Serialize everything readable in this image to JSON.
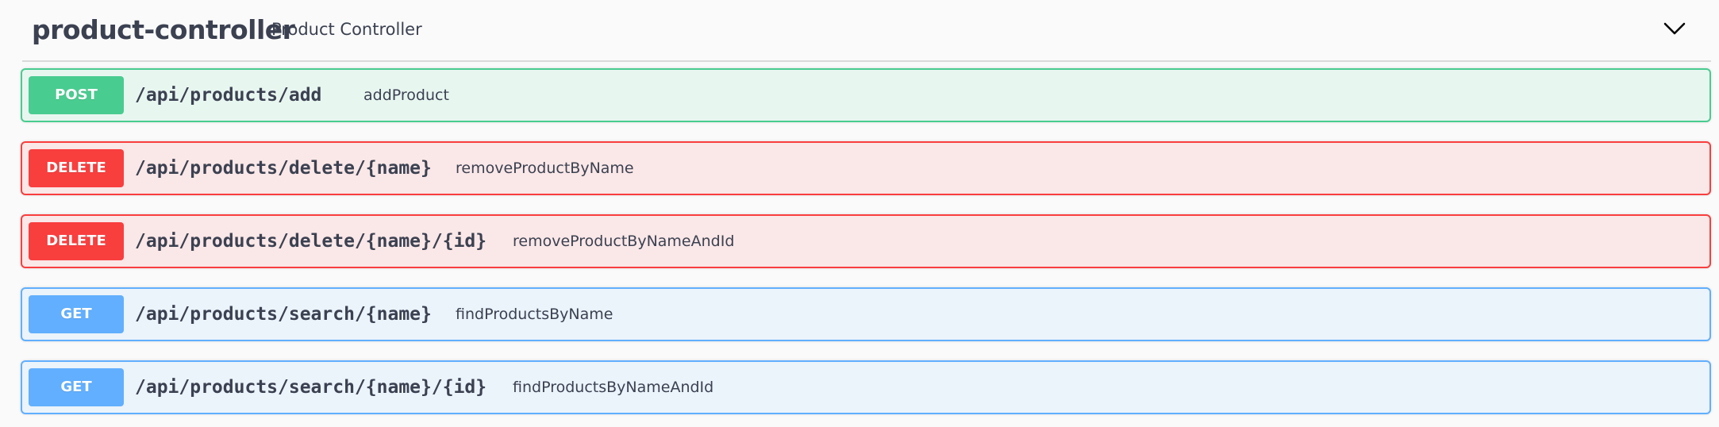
{
  "controller": {
    "name": "product-controller",
    "description": "Product Controller",
    "expand_icon": "chevron-down-icon"
  },
  "operations": [
    {
      "method": "POST",
      "path": "/api/products/add",
      "summary": "addProduct"
    },
    {
      "method": "DELETE",
      "path": "/api/products/delete/{name}",
      "summary": "removeProductByName"
    },
    {
      "method": "DELETE",
      "path": "/api/products/delete/{name}/{id}",
      "summary": "removeProductByNameAndId"
    },
    {
      "method": "GET",
      "path": "/api/products/search/{name}",
      "summary": "findProductsByName"
    },
    {
      "method": "GET",
      "path": "/api/products/search/{name}/{id}",
      "summary": "findProductsByNameAndId"
    }
  ],
  "colors": {
    "post": "#49cc90",
    "delete": "#f93e3e",
    "get": "#61affe",
    "text": "#3b4151"
  }
}
